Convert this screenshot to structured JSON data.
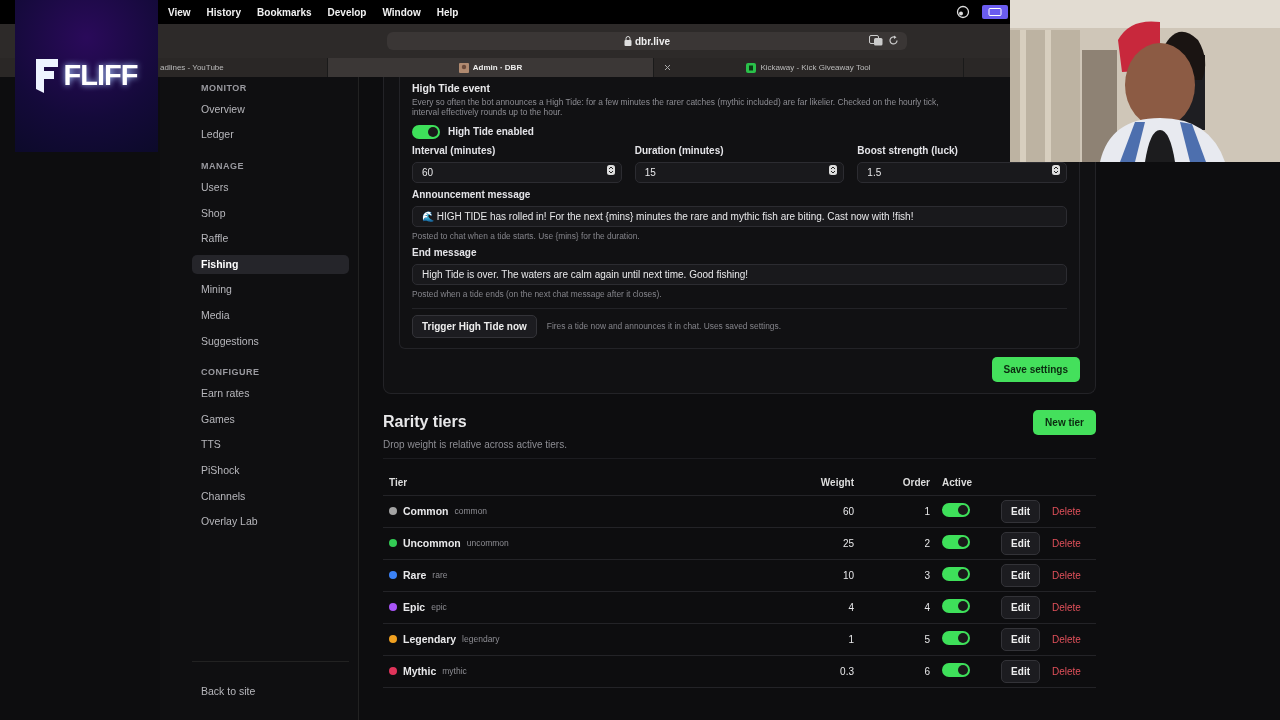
{
  "logo": {
    "text": "FLIFF"
  },
  "menu_bar": {
    "items": [
      "View",
      "History",
      "Bookmarks",
      "Develop",
      "Window",
      "Help"
    ]
  },
  "address_bar": {
    "url": "dbr.live"
  },
  "browser_tabs": [
    {
      "title": "adlines - YouTube",
      "selected": false,
      "closable": false
    },
    {
      "title": "Admin · DBR",
      "selected": true,
      "closable": false
    },
    {
      "title": "Kickaway - Kick Giveaway Tool",
      "selected": false,
      "closable": true
    }
  ],
  "sidebar": {
    "sections": [
      {
        "heading": "MONITOR",
        "items": [
          {
            "label": "Overview",
            "selected": false
          },
          {
            "label": "Ledger",
            "selected": false
          }
        ]
      },
      {
        "heading": "MANAGE",
        "items": [
          {
            "label": "Users",
            "selected": false
          },
          {
            "label": "Shop",
            "selected": false
          },
          {
            "label": "Raffle",
            "selected": false
          },
          {
            "label": "Fishing",
            "selected": true
          },
          {
            "label": "Mining",
            "selected": false
          },
          {
            "label": "Media",
            "selected": false
          },
          {
            "label": "Suggestions",
            "selected": false
          }
        ]
      },
      {
        "heading": "CONFIGURE",
        "items": [
          {
            "label": "Earn rates",
            "selected": false
          },
          {
            "label": "Games",
            "selected": false
          },
          {
            "label": "TTS",
            "selected": false
          },
          {
            "label": "PiShock",
            "selected": false
          },
          {
            "label": "Channels",
            "selected": false
          },
          {
            "label": "Overlay Lab",
            "selected": false
          }
        ]
      }
    ],
    "footer_link": "Back to site"
  },
  "high_tide": {
    "title": "High Tide event",
    "description_lines": [
      "Every so often the bot announces a High Tide: for a few minutes the rarer catches (mythic included) are far likelier. Checked on the hourly tick,",
      "interval effectively rounds up to the hour."
    ],
    "enabled": true,
    "toggle_label": "High Tide enabled",
    "fields": [
      {
        "label": "Interval (minutes)",
        "value": "60"
      },
      {
        "label": "Duration (minutes)",
        "value": "15"
      },
      {
        "label": "Boost strength (luck)",
        "value": "1.5"
      }
    ],
    "announcement": {
      "label": "Announcement message",
      "value": "🌊 HIGH TIDE has rolled in! For the next {mins} minutes the rare and mythic fish are biting. Cast now with !fish!",
      "help": "Posted to chat when a tide starts. Use {mins} for the duration."
    },
    "end_message": {
      "label": "End message",
      "value": "High Tide is over. The waters are calm again until next time. Good fishing!",
      "help": "Posted when a tide ends (on the next chat message after it closes)."
    },
    "trigger_button": "Trigger High Tide now",
    "trigger_help": "Fires a tide now and announces it in chat. Uses saved settings."
  },
  "save_button": "Save settings",
  "rarity": {
    "title": "Rarity tiers",
    "subtitle": "Drop weight is relative across active tiers.",
    "new_button": "New tier",
    "columns": [
      "Tier",
      "Weight",
      "Order",
      "Active"
    ],
    "rows": [
      {
        "name": "Common",
        "key": "common",
        "color": "#a3a3a3",
        "weight": "60",
        "order": "1",
        "active": true,
        "edit": "Edit",
        "delete": "Delete"
      },
      {
        "name": "Uncommon",
        "key": "uncommon",
        "color": "#33cc55",
        "weight": "25",
        "order": "2",
        "active": true,
        "edit": "Edit",
        "delete": "Delete"
      },
      {
        "name": "Rare",
        "key": "rare",
        "color": "#3b82f6",
        "weight": "10",
        "order": "3",
        "active": true,
        "edit": "Edit",
        "delete": "Delete"
      },
      {
        "name": "Epic",
        "key": "epic",
        "color": "#a855f7",
        "weight": "4",
        "order": "4",
        "active": true,
        "edit": "Edit",
        "delete": "Delete"
      },
      {
        "name": "Legendary",
        "key": "legendary",
        "color": "#f0a020",
        "weight": "1",
        "order": "5",
        "active": true,
        "edit": "Edit",
        "delete": "Delete"
      },
      {
        "name": "Mythic",
        "key": "mythic",
        "color": "#e0345a",
        "weight": "0.3",
        "order": "6",
        "active": true,
        "edit": "Edit",
        "delete": "Delete"
      }
    ]
  }
}
